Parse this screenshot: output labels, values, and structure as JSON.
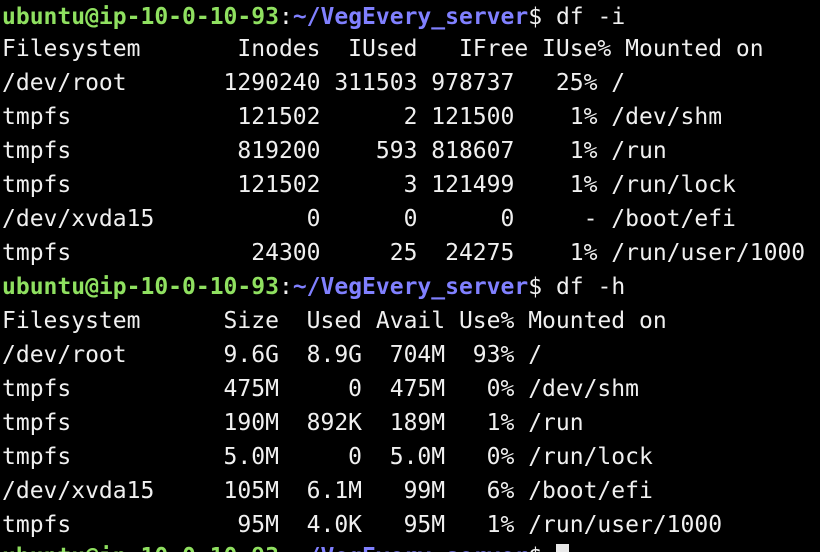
{
  "terminal": {
    "prompt_user_host": "ubuntu@ip-10-0-10-93",
    "prompt_sep": ":",
    "prompt_path": "~/VegEvery_server",
    "prompt_symbol": "$",
    "command_1": "df -i",
    "command_2": "df -h",
    "inode_table": {
      "header": "Filesystem       Inodes  IUsed   IFree IUse% Mounted on",
      "rows": [
        "/dev/root       1290240 311503 978737   25% /",
        "tmpfs            121502      2 121500    1% /dev/shm",
        "tmpfs            819200    593 818607    1% /run",
        "tmpfs            121502      3 121499    1% /run/lock",
        "/dev/xvda15           0      0      0     - /boot/efi",
        "tmpfs             24300     25  24275    1% /run/user/1000"
      ]
    },
    "size_table": {
      "header": "Filesystem      Size  Used Avail Use% Mounted on",
      "rows": [
        "/dev/root       9.6G  8.9G  704M  93% /",
        "tmpfs           475M     0  475M   0% /dev/shm",
        "tmpfs           190M  892K  189M   1% /run",
        "tmpfs           5.0M     0  5.0M   0% /run/lock",
        "/dev/xvda15     105M  6.1M   99M   6% /boot/efi",
        "tmpfs            95M  4.0K   95M   1% /run/user/1000"
      ]
    }
  }
}
